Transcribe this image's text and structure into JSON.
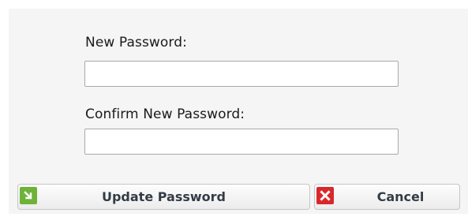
{
  "form": {
    "new_password_label": "New Password:",
    "new_password_value": "",
    "confirm_password_label": "Confirm New Password:",
    "confirm_password_value": ""
  },
  "buttons": {
    "update_label": "Update Password",
    "update_icon": "arrow-down-right-icon",
    "cancel_label": "Cancel",
    "cancel_icon": "close-icon"
  },
  "colors": {
    "update_icon_bg": "#6fb23a",
    "cancel_icon_bg": "#d8282b",
    "button_text": "#333c46"
  }
}
